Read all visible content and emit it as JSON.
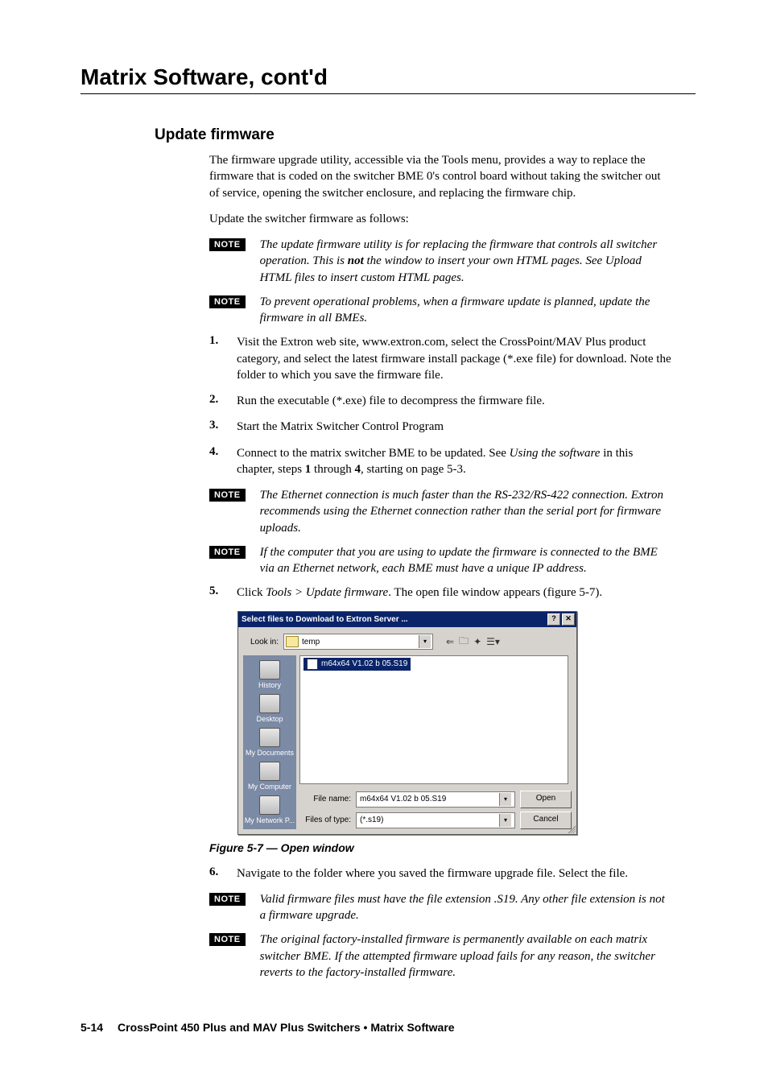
{
  "chapter_title": "Matrix Software, cont'd",
  "section_heading": "Update firmware",
  "intro_p1": "The firmware upgrade utility, accessible via the Tools menu,  provides a way to replace the firmware that is coded on the switcher BME 0's control board without taking the switcher out of service, opening the switcher enclosure, and replacing the firmware chip.",
  "intro_p2": "Update the switcher firmware as follows:",
  "note_label": "NOTE",
  "note1_a": "The update firmware utility is for replacing the firmware that controls all switcher operation.  This is ",
  "note1_not": "not",
  "note1_b": " the window to insert your own HTML pages.  See Upload HTML files to insert custom HTML pages.",
  "note2": "To prevent operational problems, when a firmware update is planned, update the firmware in all BMEs.",
  "step1_num": "1.",
  "step1": "Visit the Extron web site, www.extron.com, select the CrossPoint/MAV Plus product category, and select the latest firmware install package (*.exe file) for download.  Note the folder to which you save the firmware file.",
  "step2_num": "2.",
  "step2": "Run the executable (*.exe) file to decompress the firmware file.",
  "step3_num": "3.",
  "step3": "Start the Matrix Switcher Control Program",
  "step4_num": "4.",
  "step4_a": "Connect to the matrix switcher BME to be updated.  See ",
  "step4_ital": "Using the software",
  "step4_b": " in this chapter, steps ",
  "step4_bold1": "1",
  "step4_c": " through ",
  "step4_bold2": "4",
  "step4_d": ", starting on page 5-3.",
  "note3": "The Ethernet connection is much faster than the RS-232/RS-422 connection.  Extron recommends using the Ethernet connection rather than the serial port for firmware uploads.",
  "note4": "If the computer that you are using to update the firmware is connected to the BME via an Ethernet network, each BME must have a unique IP address.",
  "step5_num": "5.",
  "step5_a": "Click ",
  "step5_ital": "Tools > Update firmware",
  "step5_b": ".  The open file window appears (figure 5-7).",
  "dialog": {
    "title": "Select files to Download to Extron Server ...",
    "help_btn": "?",
    "close_btn": "✕",
    "lookin_label": "Look in:",
    "lookin_value": "temp",
    "places": {
      "history": "History",
      "desktop": "Desktop",
      "documents": "My Documents",
      "computer": "My Computer",
      "network": "My Network P..."
    },
    "selected_file": "m64x64 V1.02 b 05.S19",
    "filename_label": "File name:",
    "filename_value": "m64x64 V1.02 b 05.S19",
    "filetype_label": "Files of type:",
    "filetype_value": "(*.s19)",
    "open_btn": "Open",
    "cancel_btn": "Cancel"
  },
  "figure_caption": "Figure 5-7 — Open window",
  "step6_num": "6.",
  "step6": "Navigate to the folder where you saved the firmware upgrade file.  Select the file.",
  "note5": "Valid firmware files must have the file extension .S19.  Any other file extension is not a firmware upgrade.",
  "note6": "The original factory-installed firmware is permanently available on each matrix switcher BME.  If the attempted firmware upload fails for any reason, the switcher reverts to the factory-installed firmware.",
  "footer": {
    "page": "5-14",
    "text": "CrossPoint 450 Plus and MAV Plus Switchers • Matrix Software"
  }
}
